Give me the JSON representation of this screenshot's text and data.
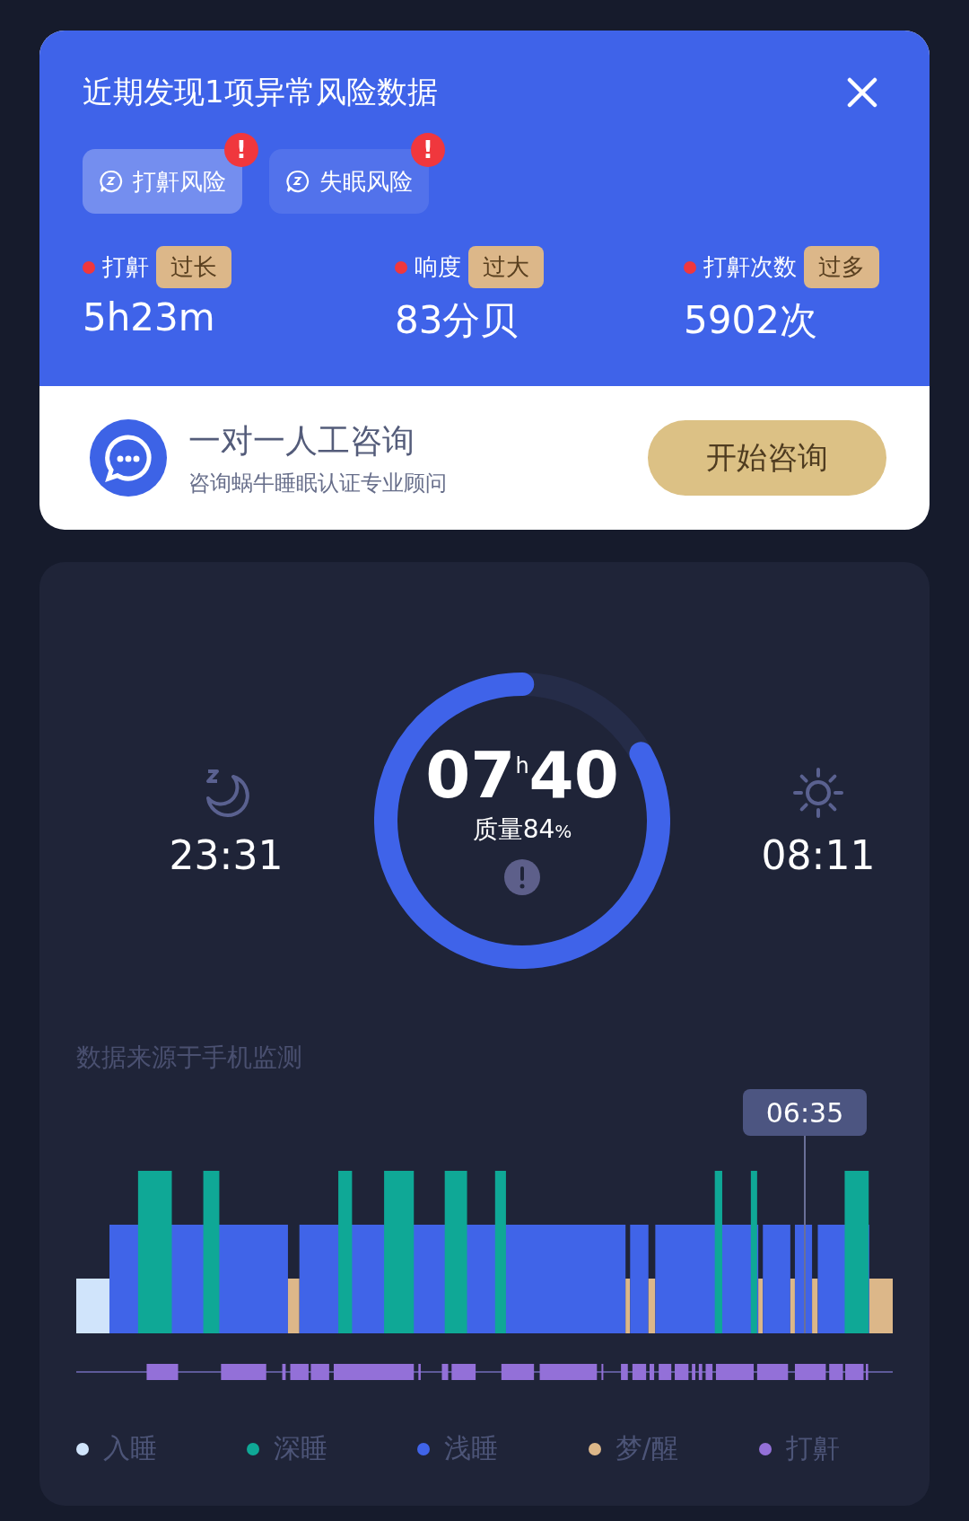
{
  "alert": {
    "title": "近期发现1项异常风险数据",
    "tabs": [
      {
        "label": "打鼾风险",
        "selected": true,
        "badge": "!"
      },
      {
        "label": "失眠风险",
        "selected": false,
        "badge": "!"
      }
    ],
    "metrics": [
      {
        "label": "打鼾",
        "tag": "过长",
        "value": "5h23m"
      },
      {
        "label": "响度",
        "tag": "过大",
        "value": "83分贝"
      },
      {
        "label": "打鼾次数",
        "tag": "过多",
        "value": "5902次"
      }
    ]
  },
  "consult": {
    "title": "一对一人工咨询",
    "subtitle": "咨询蜗牛睡眠认证专业顾问",
    "button": "开始咨询"
  },
  "sleep": {
    "bedtime": "23:31",
    "wake_time": "08:11",
    "hours": "07",
    "hours_unit": "h",
    "minutes": "40",
    "quality_label": "质量84",
    "quality_unit": "%",
    "level": 0.84,
    "source": "数据来源于手机监测",
    "tooltip": "06:35",
    "legend": [
      {
        "label": "入睡",
        "color": "#d0e4fb"
      },
      {
        "label": "深睡",
        "color": "#0fa896"
      },
      {
        "label": "浅睡",
        "color": "#4064e8"
      },
      {
        "label": "梦/醒",
        "color": "#dcb789"
      },
      {
        "label": "打鼾",
        "color": "#9370d8"
      }
    ]
  }
}
